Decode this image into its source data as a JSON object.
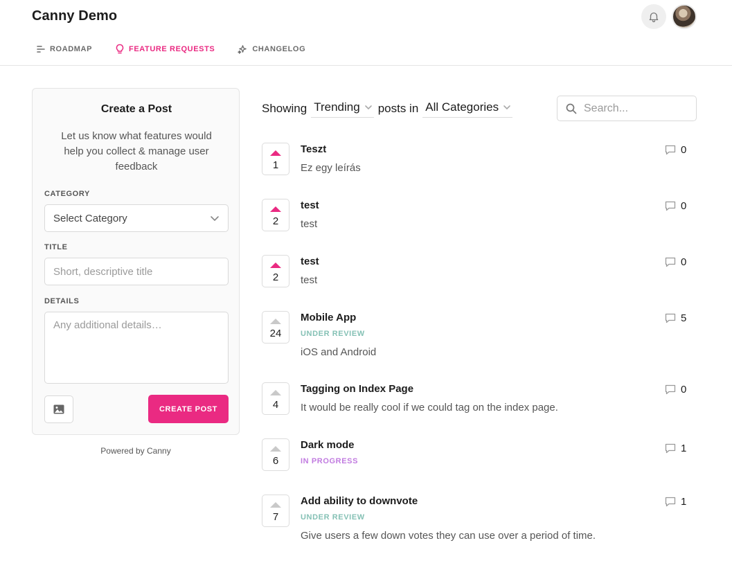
{
  "app": {
    "title": "Canny Demo"
  },
  "nav": {
    "items": [
      {
        "label": "ROADMAP",
        "icon": "roadmap-icon"
      },
      {
        "label": "FEATURE REQUESTS",
        "icon": "lightbulb-icon",
        "active": true
      },
      {
        "label": "CHANGELOG",
        "icon": "sparkle-icon"
      }
    ]
  },
  "create_post": {
    "title": "Create a Post",
    "description": "Let us know what features would help you collect & manage user feedback",
    "category_label": "CATEGORY",
    "category_value": "Select Category",
    "title_label": "TITLE",
    "title_placeholder": "Short, descriptive title",
    "details_label": "DETAILS",
    "details_placeholder": "Any additional details…",
    "submit_label": "CREATE POST"
  },
  "powered_by": "Powered by Canny",
  "filter": {
    "showing_label": "Showing",
    "sort_value": "Trending",
    "posts_in_label": "posts in",
    "category_value": "All Categories",
    "search_placeholder": "Search..."
  },
  "posts": [
    {
      "title": "Teszt",
      "status": "",
      "description": "Ez egy leírás",
      "votes": "1",
      "voted": true,
      "comments": "0"
    },
    {
      "title": "test",
      "status": "",
      "description": "test",
      "votes": "2",
      "voted": true,
      "comments": "0"
    },
    {
      "title": "test",
      "status": "",
      "description": "test",
      "votes": "2",
      "voted": true,
      "comments": "0"
    },
    {
      "title": "Mobile App",
      "status": "UNDER REVIEW",
      "description": "iOS and Android",
      "votes": "24",
      "voted": false,
      "comments": "5"
    },
    {
      "title": "Tagging on Index Page",
      "status": "",
      "description": "It would be really cool if we could tag on the index page.",
      "votes": "4",
      "voted": false,
      "comments": "0"
    },
    {
      "title": "Dark mode",
      "status": "IN PROGRESS",
      "description": "",
      "votes": "6",
      "voted": false,
      "comments": "1"
    },
    {
      "title": "Add ability to downvote",
      "status": "UNDER REVIEW",
      "description": "Give users a few down votes they can use over a period of time.",
      "votes": "7",
      "voted": false,
      "comments": "1"
    }
  ],
  "colors": {
    "accent": "#ea2a82",
    "under_review": "#85c1b5",
    "in_progress": "#c17be0"
  }
}
